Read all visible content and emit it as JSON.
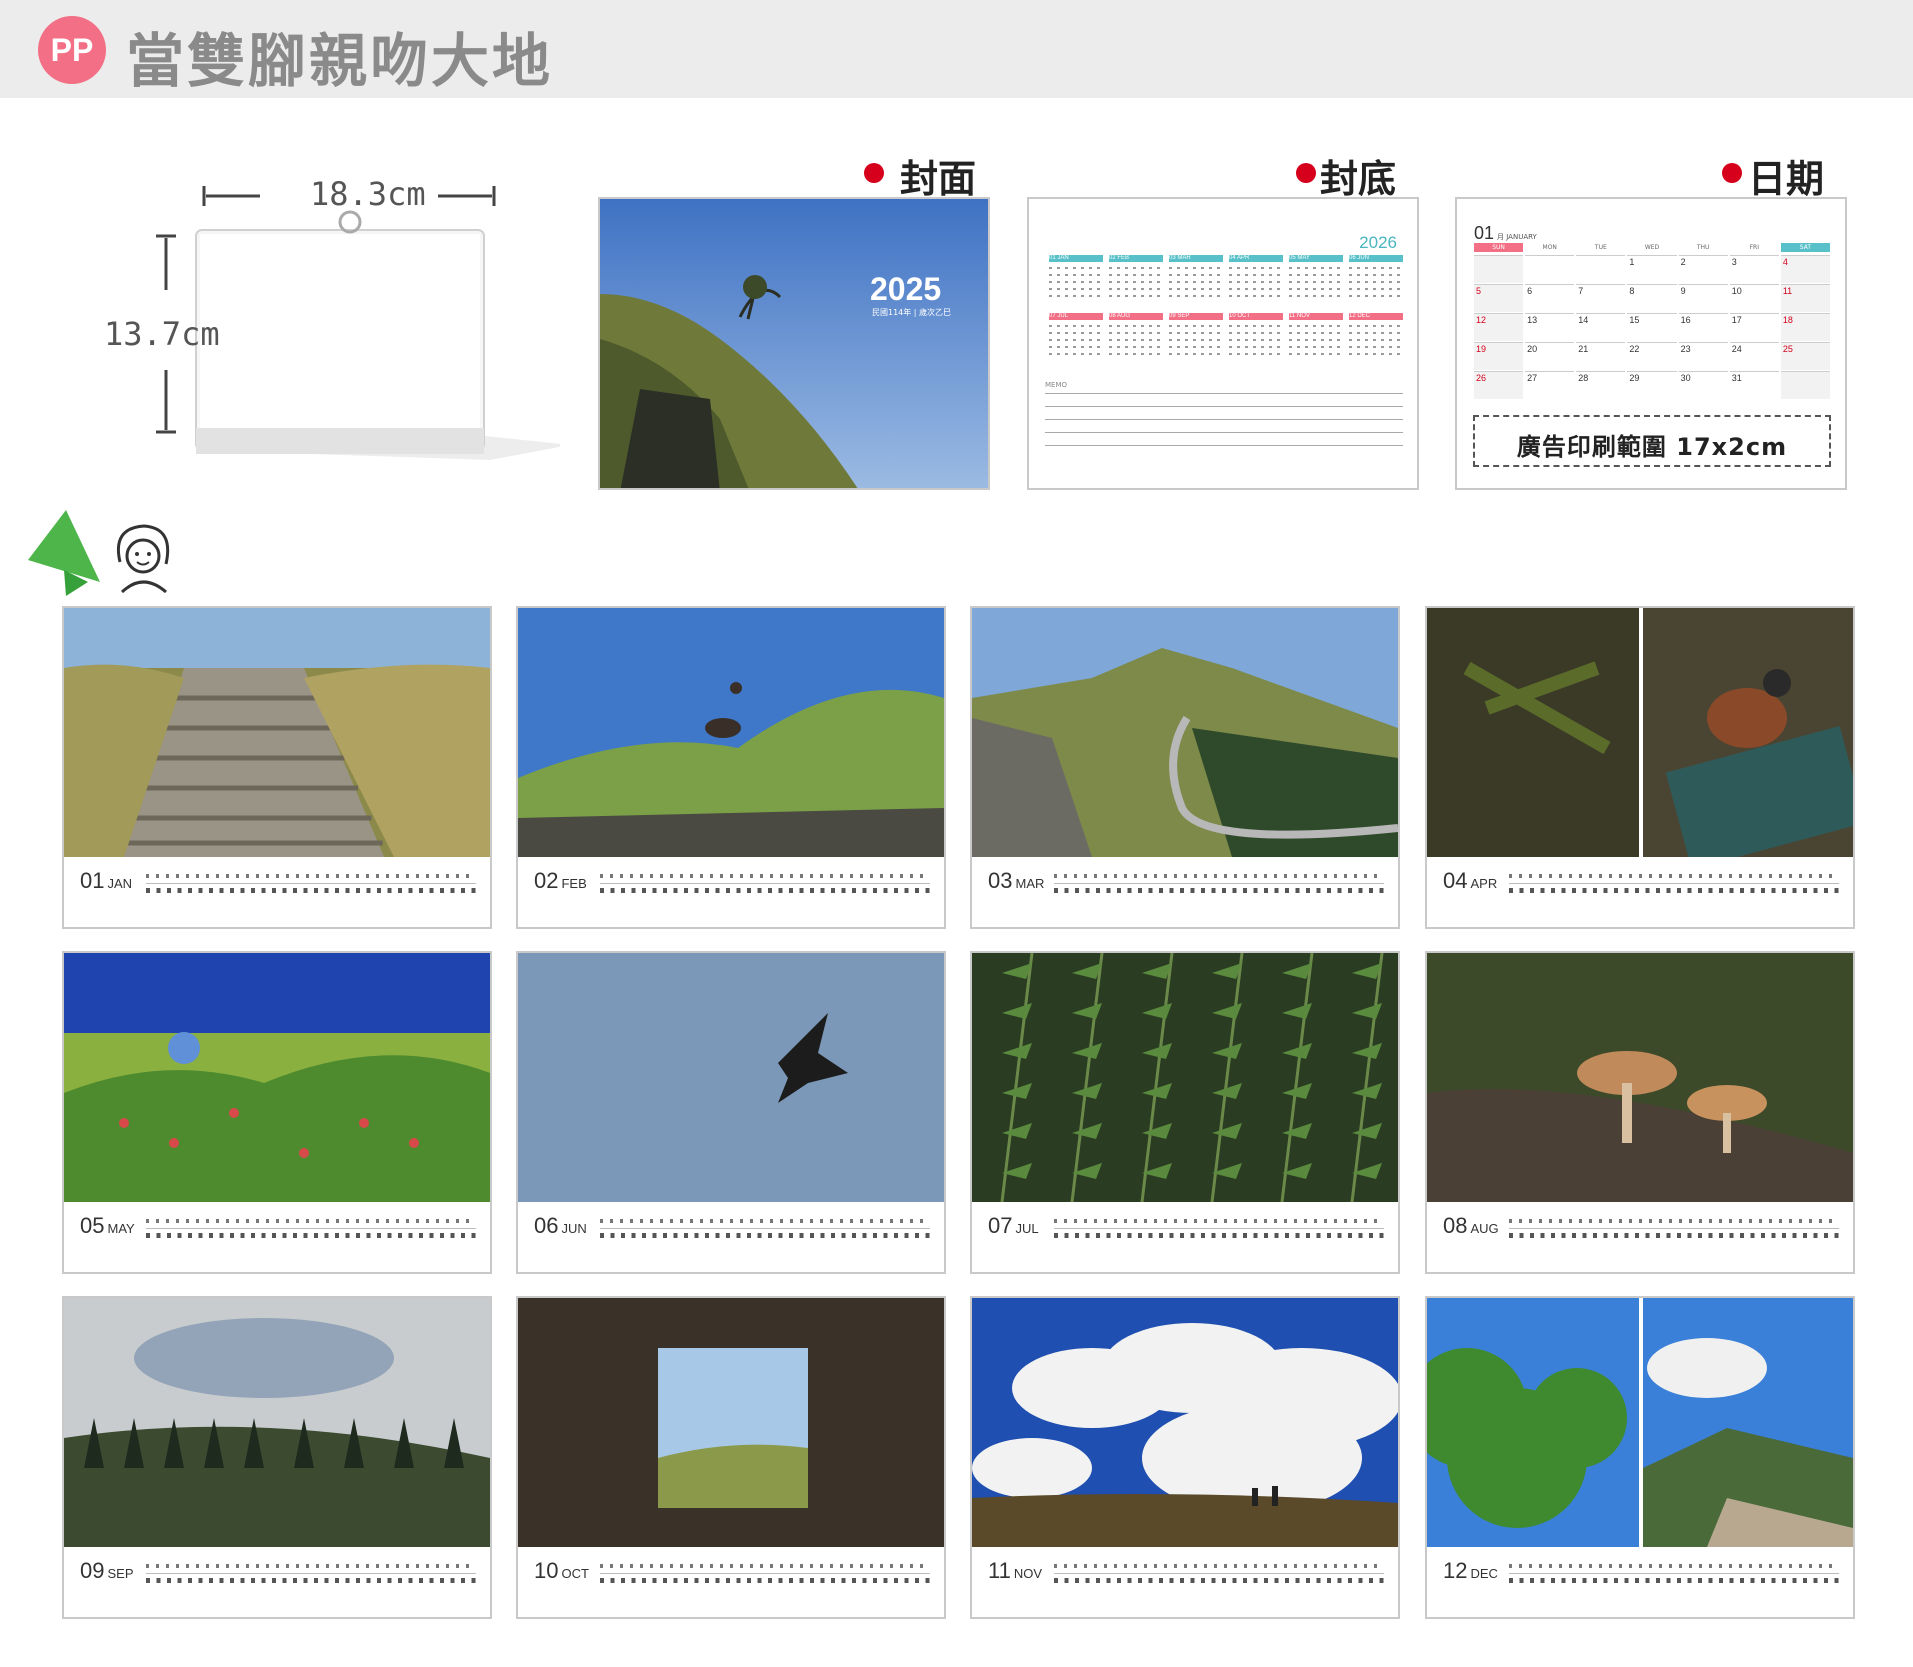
{
  "header": {
    "logo": "PP",
    "title": "當雙腳親吻大地"
  },
  "size": {
    "width_label": "18.3cm",
    "height_label": "13.7cm"
  },
  "sections": {
    "cover": "封面",
    "back": "封底",
    "date": "日期"
  },
  "cover": {
    "year": "2025",
    "sub": "民國114年 | 歲次乙巳"
  },
  "back": {
    "year": "2026",
    "memo": "MEMO",
    "months": [
      "01",
      "02",
      "03",
      "04",
      "05",
      "06",
      "07",
      "08",
      "09",
      "10",
      "11",
      "12"
    ],
    "month_names": [
      "JAN",
      "FEB",
      "MAR",
      "APR",
      "MAY",
      "JUN",
      "JUL",
      "AUG",
      "SEP",
      "OCT",
      "NOV",
      "DEC"
    ]
  },
  "date_sample": {
    "month": "01",
    "month_label": "月 JANUARY",
    "days": [
      "SUN",
      "MON",
      "TUE",
      "WED",
      "THU",
      "FRI",
      "SAT"
    ],
    "ad_text": "廣告印刷範圍 17x2cm"
  },
  "months": [
    {
      "num": "01",
      "name": "JAN",
      "photo": "stairs"
    },
    {
      "num": "02",
      "name": "FEB",
      "photo": "bird-grass"
    },
    {
      "num": "03",
      "name": "MAR",
      "photo": "mountain-road"
    },
    {
      "num": "04",
      "name": "APR",
      "photo": "bird-pine"
    },
    {
      "num": "05",
      "name": "MAY",
      "photo": "flowers"
    },
    {
      "num": "06",
      "name": "JUN",
      "photo": "eagle-sky"
    },
    {
      "num": "07",
      "name": "JUL",
      "photo": "fern"
    },
    {
      "num": "08",
      "name": "AUG",
      "photo": "mushroom"
    },
    {
      "num": "09",
      "name": "SEP",
      "photo": "misty-forest"
    },
    {
      "num": "10",
      "name": "OCT",
      "photo": "window"
    },
    {
      "num": "11",
      "name": "NOV",
      "photo": "clouds-hikers"
    },
    {
      "num": "12",
      "name": "DEC",
      "photo": "pine-valley"
    }
  ],
  "colors": {
    "accent_red": "#d6001c",
    "sat_blue": "#58c0c8",
    "sun_pink": "#f36f86",
    "logo": "#f36f86"
  }
}
